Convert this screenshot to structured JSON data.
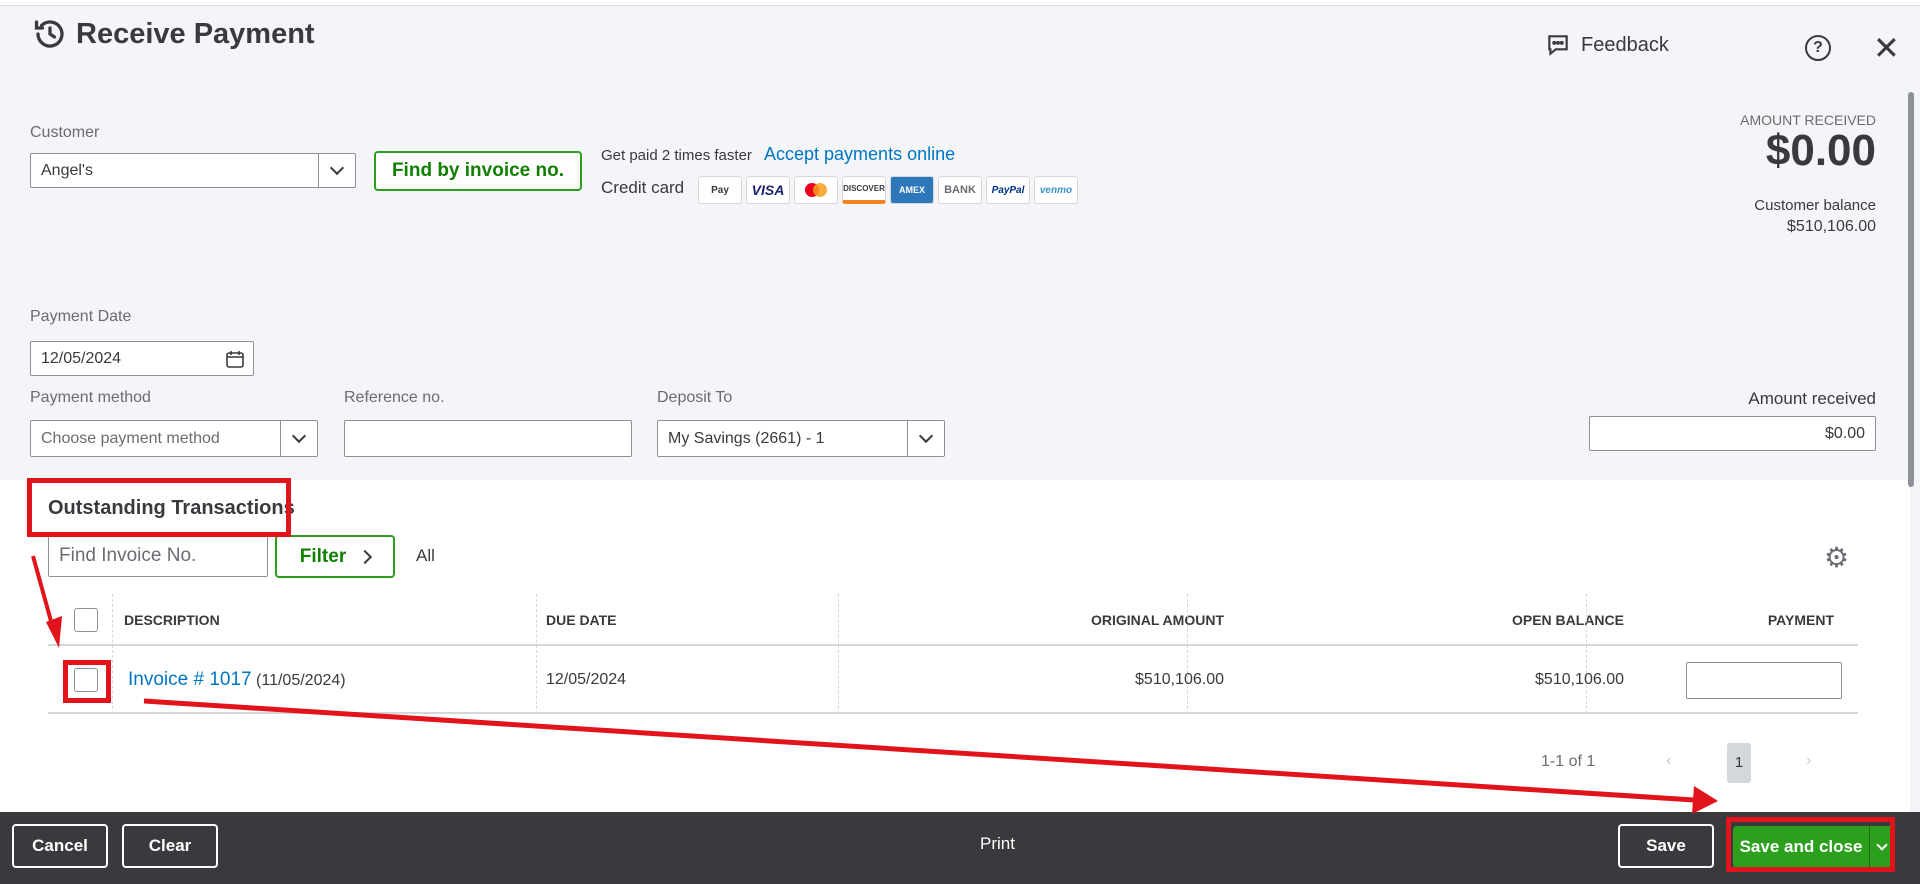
{
  "header": {
    "title": "Receive Payment",
    "feedback_label": "Feedback",
    "help_label": "?",
    "close_label": "✕"
  },
  "customer": {
    "label": "Customer",
    "value": "Angel's"
  },
  "find_by_invoice_label": "Find by invoice no.",
  "online_payments": {
    "promo_text": "Get paid 2 times faster",
    "link_text": "Accept payments online",
    "credit_card_label": "Credit card",
    "cards": [
      "Pay",
      "VISA",
      "",
      "DISCOVER",
      "AMEX",
      "BANK",
      "PayPal",
      "venmo"
    ]
  },
  "summary": {
    "amount_received_label": "AMOUNT RECEIVED",
    "amount_received_value": "$0.00",
    "customer_balance_label": "Customer balance",
    "customer_balance_value": "$510,106.00"
  },
  "payment_date": {
    "label": "Payment Date",
    "value": "12/05/2024"
  },
  "payment_method": {
    "label": "Payment method",
    "placeholder": "Choose payment method"
  },
  "reference": {
    "label": "Reference no.",
    "value": ""
  },
  "deposit_to": {
    "label": "Deposit To",
    "value": "My Savings (2661) - 1"
  },
  "amount_received_field": {
    "label": "Amount received",
    "value": "$0.00"
  },
  "outstanding": {
    "title": "Outstanding Transactions",
    "find_placeholder": "Find Invoice No.",
    "filter_label": "Filter",
    "all_label": "All",
    "columns": [
      "DESCRIPTION",
      "DUE DATE",
      "ORIGINAL AMOUNT",
      "OPEN BALANCE",
      "PAYMENT"
    ],
    "rows": [
      {
        "invoice": "Invoice # 1017",
        "invoice_date": "(11/05/2024)",
        "due_date": "12/05/2024",
        "original_amount": "$510,106.00",
        "open_balance": "$510,106.00",
        "payment": ""
      }
    ],
    "pagination": {
      "summary": "1-1 of 1",
      "current_page": "1"
    }
  },
  "footer": {
    "cancel_label": "Cancel",
    "clear_label": "Clear",
    "print_label": "Print",
    "save_label": "Save",
    "save_close_label": "Save and close"
  },
  "colors": {
    "accent_green": "#2ca01c",
    "link_blue": "#0077c5",
    "annotation_red": "#e0141a",
    "footer_bg": "#393a3d"
  }
}
